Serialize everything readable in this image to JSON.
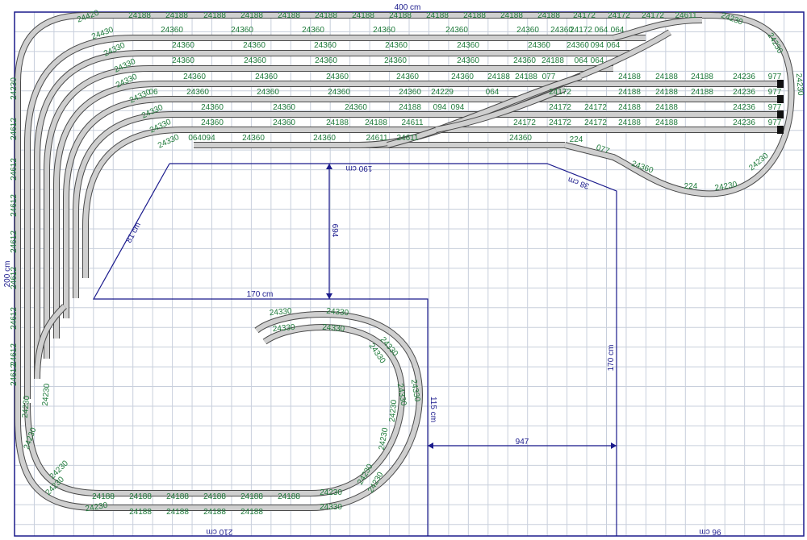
{
  "dimensions": {
    "top_width": "400 cm",
    "left_height": "200 cm",
    "bottom_left": "210 cm",
    "bottom_right": "96 cm",
    "inner_top": "190 cm",
    "inner_diag_left": "81 cm",
    "inner_diag_right": "38 cm",
    "inner_horizontal": "170 cm",
    "inner_vertical_right": "170 cm",
    "inner_depth": "115 cm",
    "mid_vertical": "694",
    "mid_horizontal": "947"
  },
  "labels": {
    "row1": [
      "24188",
      "24188",
      "24188",
      "24188",
      "24188",
      "24188",
      "24188",
      "24188",
      "24188",
      "24188",
      "24188",
      "24188",
      "24172",
      "24172",
      "24172",
      "24611"
    ],
    "row2": [
      "24360",
      "24360",
      "24360",
      "24360",
      "24360",
      "24360",
      "24360",
      "24172",
      "064",
      "064"
    ],
    "row3": [
      "24360",
      "24360",
      "24360",
      "24360",
      "24360",
      "24360",
      "24360",
      "094",
      "064"
    ],
    "row4": [
      "24360",
      "24360",
      "24360",
      "24360",
      "24360",
      "24360",
      "24188",
      "064",
      "064"
    ],
    "row5": [
      "24360",
      "24360",
      "24360",
      "24360",
      "24360",
      "24188",
      "24188",
      "077"
    ],
    "row6": [
      "06",
      "24360",
      "24360",
      "24360",
      "24360",
      "24229",
      "064"
    ],
    "row7": [
      "24360",
      "24360",
      "24360",
      "24188",
      "094",
      "094"
    ],
    "row8": [
      "24360",
      "24360",
      "24188",
      "24188",
      "24611"
    ],
    "row9": [
      "064094",
      "24360",
      "24360",
      "24611",
      "24611",
      "24360"
    ],
    "right_rows": [
      [
        "24188",
        "24188",
        "24188",
        "24236",
        "977"
      ],
      [
        "24172",
        "24188",
        "24188",
        "24188",
        "24236",
        "977"
      ],
      [
        "24172",
        "24172",
        "24188",
        "24188",
        "24236",
        "977"
      ],
      [
        "24172",
        "24172",
        "24172",
        "24188",
        "24188",
        "24236",
        "977"
      ]
    ],
    "right_curve": [
      "24230",
      "24230",
      "24230",
      "24230",
      "24230",
      "224",
      "077",
      "24360",
      "224"
    ],
    "corner_curve": [
      "24420",
      "24430",
      "24330",
      "24330",
      "24330",
      "24330",
      "24330",
      "24330",
      "24330"
    ],
    "left_column": [
      "24230",
      "24612",
      "24612",
      "24612",
      "24612",
      "24612",
      "24612",
      "24612",
      "24612"
    ],
    "bottom_left_curve": [
      "24230",
      "24230",
      "24230",
      "24230",
      "24230",
      "24230"
    ],
    "bottom_straight": [
      "24188",
      "24188",
      "24188",
      "24188",
      "24188",
      "24188",
      "24188",
      "24188",
      "24188",
      "24188"
    ],
    "spiral": [
      "24330",
      "24330",
      "24330",
      "24330",
      "24330",
      "24330",
      "24330",
      "24330",
      "24330",
      "24230",
      "24230",
      "24230",
      "24230",
      "24230"
    ]
  }
}
